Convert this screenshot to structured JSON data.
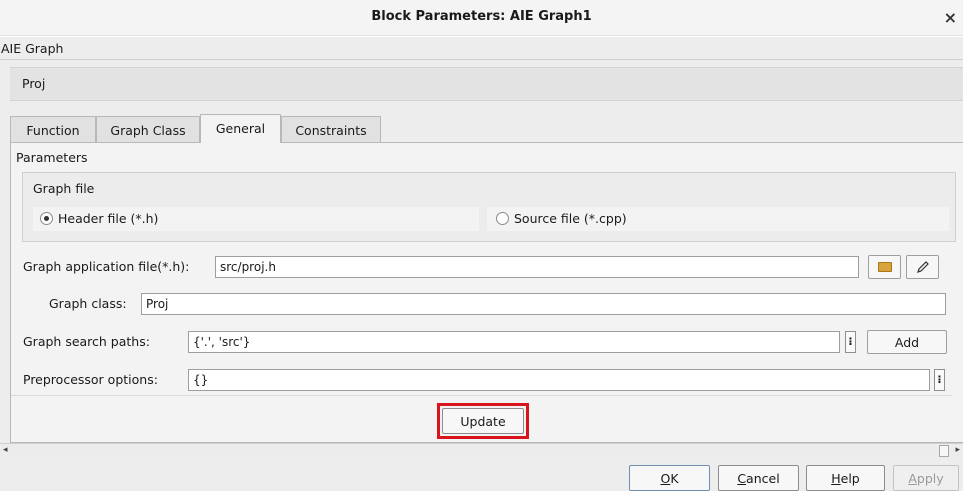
{
  "window": {
    "title": "Block Parameters: AIE Graph1",
    "close_glyph": "×"
  },
  "block": {
    "type": "AIE Graph",
    "description": "Proj"
  },
  "tabs": [
    {
      "label": "Function"
    },
    {
      "label": "Graph Class"
    },
    {
      "label": "General",
      "active": true
    },
    {
      "label": "Constraints"
    }
  ],
  "parameters": {
    "section_label": "Parameters",
    "graph_file": {
      "label": "Graph file",
      "options": [
        {
          "label": "Header file (*.h)",
          "selected": true
        },
        {
          "label": "Source file (*.cpp)",
          "selected": false
        }
      ]
    },
    "app_file": {
      "label": "Graph application file(*.h):",
      "value": "src/proj.h",
      "browse_icon": "folder-icon",
      "edit_icon": "pencil-icon"
    },
    "graph_class": {
      "label": "Graph class:",
      "value": "Proj"
    },
    "search_paths": {
      "label": "Graph search paths:",
      "value": "{'.', 'src'}",
      "more_glyph": "⁝",
      "add_label": "Add"
    },
    "preprocessor": {
      "label": "Preprocessor options:",
      "value": "{}",
      "more_glyph": "⁝"
    },
    "update_label": "Update"
  },
  "scrollbar": {
    "left_arrow": "◂",
    "right_arrow": "▸"
  },
  "footer": {
    "ok": {
      "mnemonic": "O",
      "rest": "K"
    },
    "cancel": {
      "mnemonic": "C",
      "rest": "ancel"
    },
    "help": {
      "mnemonic": "H",
      "rest": "elp"
    },
    "apply": {
      "mnemonic": "A",
      "rest": "pply",
      "disabled": true
    }
  },
  "colors": {
    "highlight": "#d9141c",
    "folder": "#d9a23a"
  }
}
